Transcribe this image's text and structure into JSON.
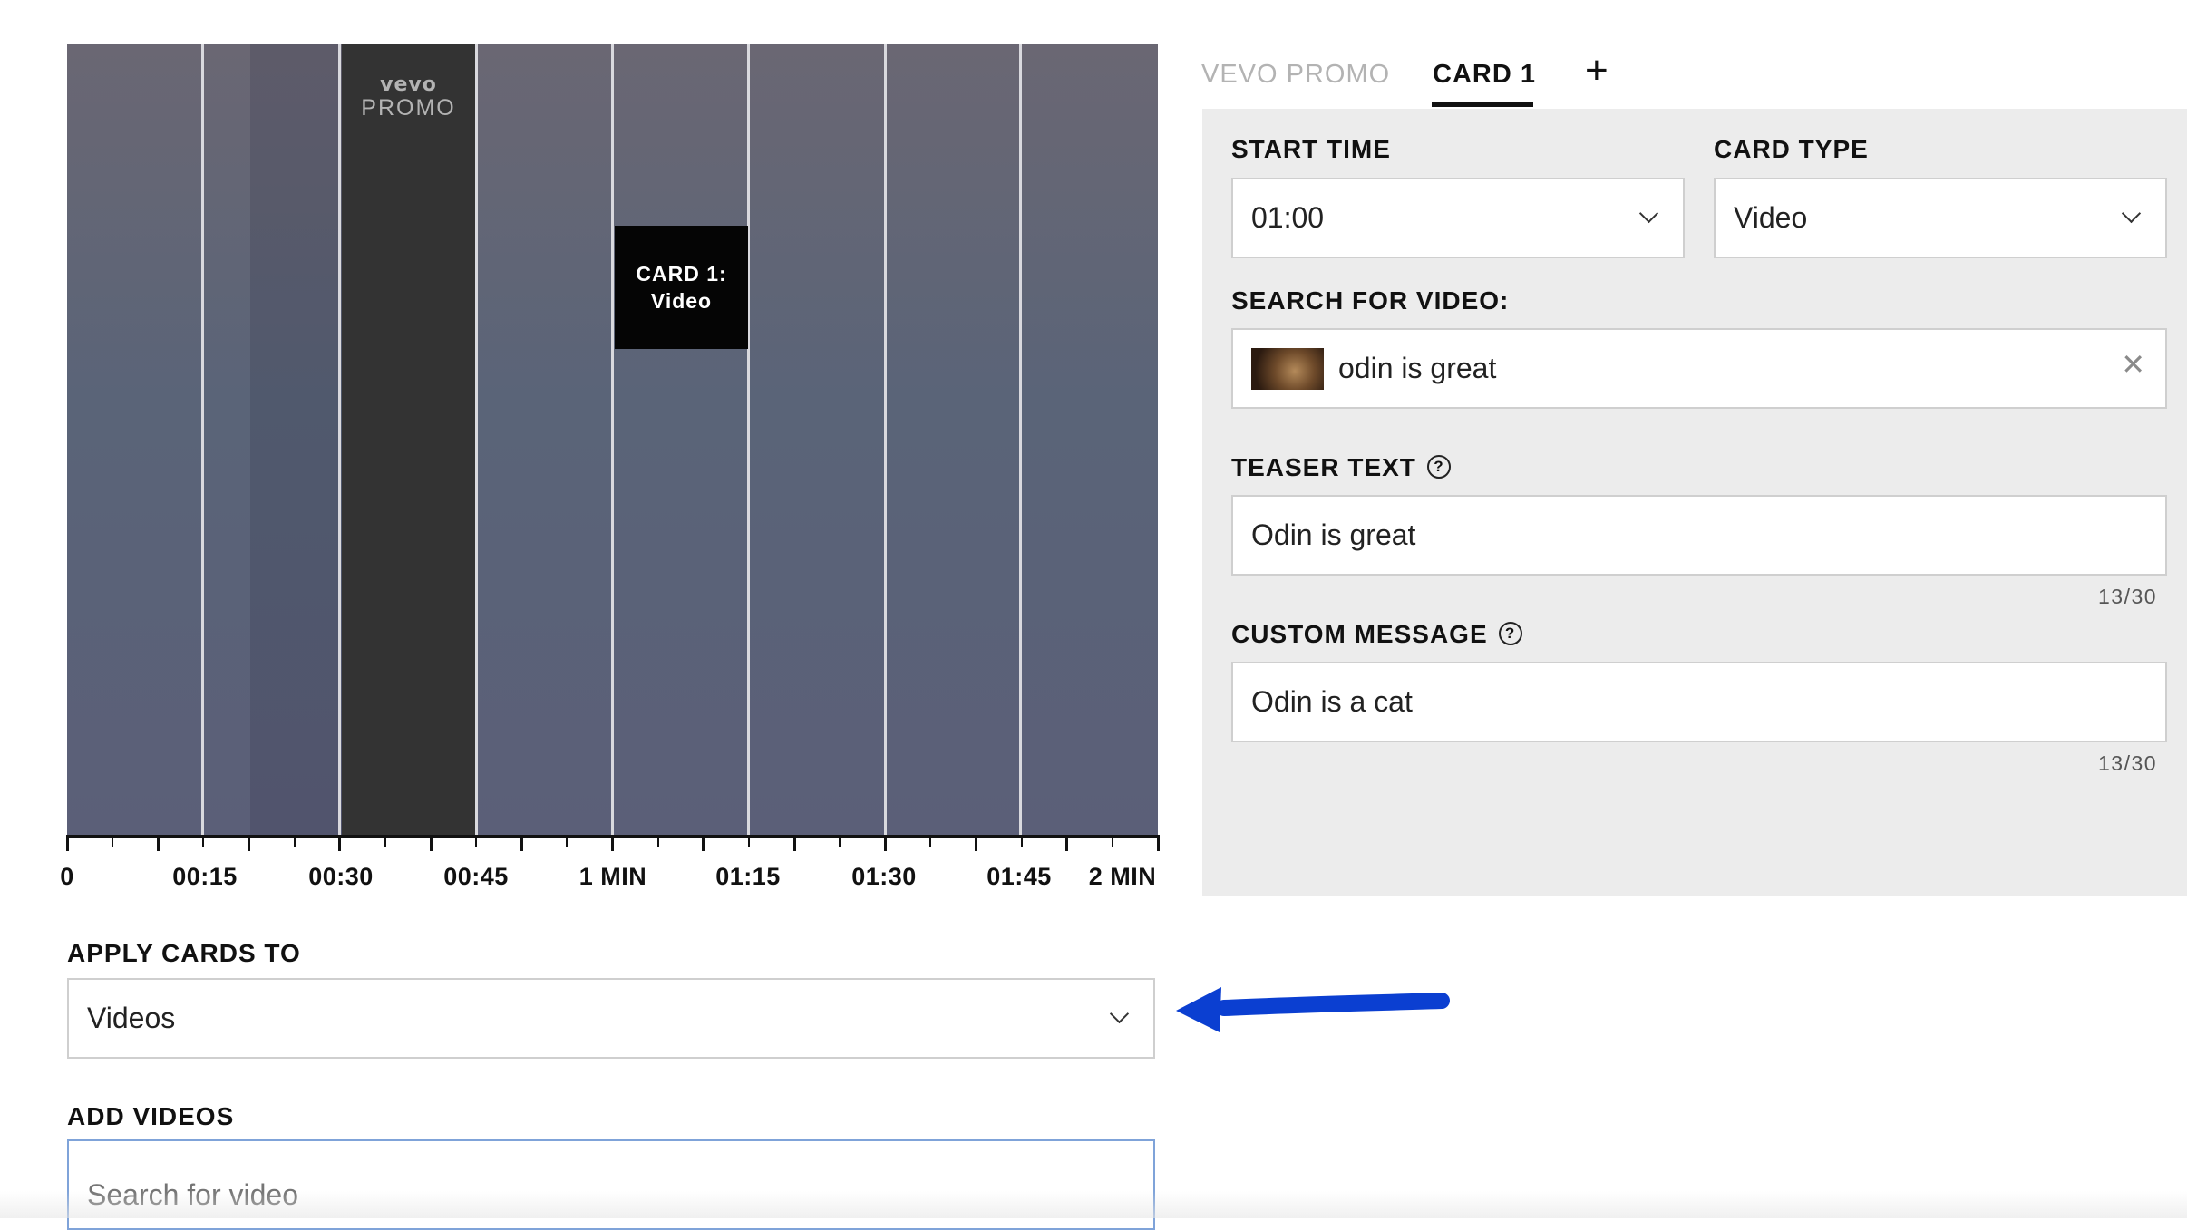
{
  "timeline": {
    "promo": {
      "brand": "vevo",
      "label": "PROMO"
    },
    "card_marker": {
      "line1": "CARD 1:",
      "line2": "Video"
    },
    "tick_labels": [
      "0",
      "00:15",
      "00:30",
      "00:45",
      "1 MIN",
      "01:15",
      "01:30",
      "01:45",
      "2 MIN"
    ]
  },
  "apply_cards": {
    "label": "APPLY CARDS TO",
    "value": "Videos"
  },
  "add_videos": {
    "label": "ADD VIDEOS",
    "placeholder": "Search for video"
  },
  "tabs": {
    "promo": "VEVO PROMO",
    "card1": "CARD 1",
    "add": "+"
  },
  "card_form": {
    "start_time": {
      "label": "START TIME",
      "value": "01:00"
    },
    "card_type": {
      "label": "CARD TYPE",
      "value": "Video"
    },
    "search_video": {
      "label": "SEARCH FOR VIDEO:",
      "value": "odin is great",
      "clear": "✕"
    },
    "teaser_text": {
      "label": "TEASER TEXT",
      "value": "Odin is great",
      "counter": "13/30",
      "help": "?"
    },
    "custom_message": {
      "label": "CUSTOM MESSAGE",
      "value": "Odin is a cat",
      "counter": "13/30",
      "help": "?"
    }
  },
  "colors": {
    "annotation_arrow": "#0b3fd1",
    "panel_bg": "#ececec",
    "promo_block": "#333333"
  }
}
